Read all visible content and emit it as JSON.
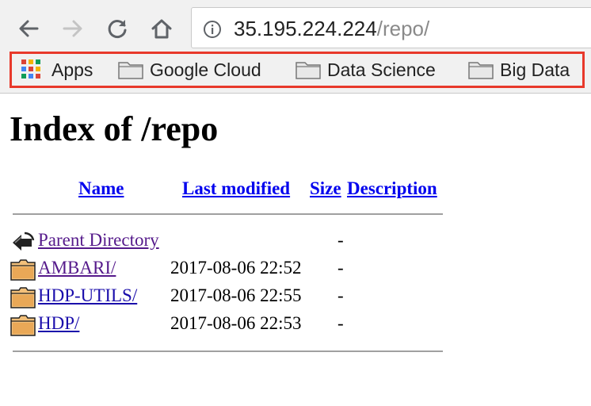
{
  "browser": {
    "url_host": "35.195.224.224",
    "url_path": "/repo/",
    "bookmarks": [
      {
        "label": "Apps",
        "icon": "apps-grid-icon"
      },
      {
        "label": "Google Cloud",
        "icon": "folder-icon"
      },
      {
        "label": "Data Science",
        "icon": "folder-icon"
      },
      {
        "label": "Big Data",
        "icon": "folder-icon"
      }
    ],
    "highlight_color": "#e8392b"
  },
  "page": {
    "title": "Index of /repo",
    "columns": {
      "name": "Name",
      "last_modified": "Last modified",
      "size": "Size",
      "description": "Description"
    },
    "rows": [
      {
        "icon": "parent-directory-icon",
        "name": "Parent Directory",
        "modified": "",
        "size": "-"
      },
      {
        "icon": "folder-icon",
        "name": "AMBARI/",
        "modified": "2017-08-06 22:52",
        "size": "-"
      },
      {
        "icon": "folder-icon",
        "name": "HDP-UTILS/",
        "modified": "2017-08-06 22:55",
        "size": "-"
      },
      {
        "icon": "folder-icon",
        "name": "HDP/",
        "modified": "2017-08-06 22:53",
        "size": "-"
      }
    ],
    "link_color": "#1a0dab",
    "visited_link_color": "#551a8b"
  }
}
